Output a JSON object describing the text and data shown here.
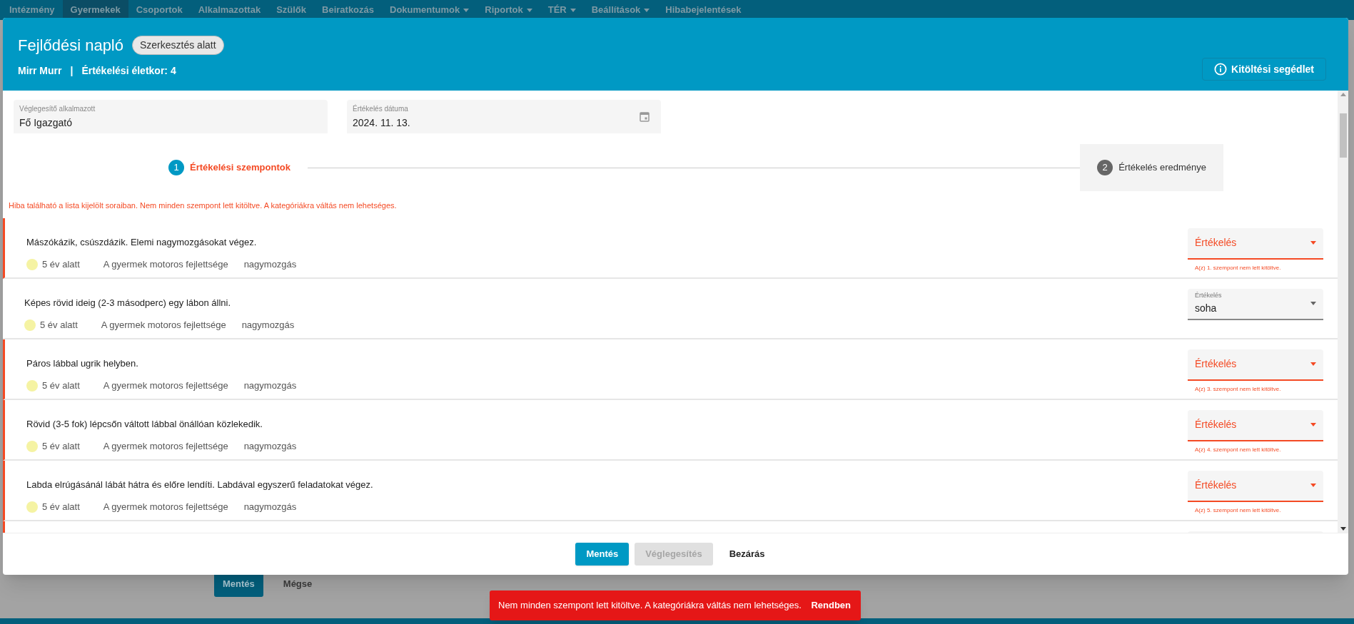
{
  "nav": [
    {
      "label": "Intézmény",
      "selected": false,
      "caret": false
    },
    {
      "label": "Gyermekek",
      "selected": true,
      "caret": false
    },
    {
      "label": "Csoportok",
      "selected": false,
      "caret": false
    },
    {
      "label": "Alkalmazottak",
      "selected": false,
      "caret": false
    },
    {
      "label": "Szülők",
      "selected": false,
      "caret": false
    },
    {
      "label": "Beiratkozás",
      "selected": false,
      "caret": false
    },
    {
      "label": "Dokumentumok",
      "selected": false,
      "caret": true
    },
    {
      "label": "Riportok",
      "selected": false,
      "caret": true
    },
    {
      "label": "TÉR",
      "selected": false,
      "caret": true
    },
    {
      "label": "Beállítások",
      "selected": false,
      "caret": true
    },
    {
      "label": "Hibabejelentések",
      "selected": false,
      "caret": false
    }
  ],
  "background_buttons": [
    {
      "label": "Mentés",
      "kind": "primary"
    },
    {
      "label": "Mégse",
      "kind": "text"
    }
  ],
  "dialog": {
    "title": "Fejlődési napló",
    "badge": "Szerkesztés alatt",
    "child": "Mirr Murr",
    "separator": "|",
    "age": "Értékelési életkor: 4",
    "help_button": "Kitöltési segédlet",
    "fields": [
      {
        "label": "Véglegesítő alkalmazott",
        "value": "Fő Igazgató",
        "kind": "text"
      },
      {
        "label": "Értékelés dátuma",
        "value": "2024. 11. 13.",
        "kind": "date"
      }
    ],
    "steps": [
      {
        "number": "1",
        "label": "Értékelési szempontok",
        "selected": true,
        "error": true
      },
      {
        "number": "2",
        "label": "Értékelés eredménye",
        "selected": false,
        "error": false
      }
    ],
    "error_message": "Hiba található a lista kijelölt soraiban. Nem minden szempont lett kitöltve. A kategóriákra váltás nem lehetséges.",
    "rows": [
      {
        "text": "Mászókázik, csúszdázik. Elemi nagymozgásokat végez.",
        "age": "5 év alatt",
        "color": "#f5f3a3",
        "area": "A gyermek motoros fejlettsége",
        "category": "nagymozgás",
        "error": true,
        "rating_label": "Értékelés",
        "helper": "A(z) 1. szempont nem lett kitöltve."
      },
      {
        "text": "Képes rövid ideig (2-3 másodperc) egy lábon állni.",
        "age": "5 év alatt",
        "color": "#f5f3a3",
        "area": "A gyermek motoros fejlettsége",
        "category": "nagymozgás",
        "error": false,
        "rating_label": "Értékelés",
        "rating_value": "soha"
      },
      {
        "text": "Páros lábbal ugrik helyben.",
        "age": "5 év alatt",
        "color": "#f5f3a3",
        "area": "A gyermek motoros fejlettsége",
        "category": "nagymozgás",
        "error": true,
        "rating_label": "Értékelés",
        "helper": "A(z) 3. szempont nem lett kitöltve."
      },
      {
        "text": "Rövid (3-5 fok) lépcsőn váltott lábbal önállóan közlekedik.",
        "age": "5 év alatt",
        "color": "#f5f3a3",
        "area": "A gyermek motoros fejlettsége",
        "category": "nagymozgás",
        "error": true,
        "rating_label": "Értékelés",
        "helper": "A(z) 4. szempont nem lett kitöltve."
      },
      {
        "text": "Labda elrúgásánál lábát hátra és előre lendíti. Labdával egyszerű feladatokat végez.",
        "age": "5 év alatt",
        "color": "#f5f3a3",
        "area": "A gyermek motoros fejlettsége",
        "category": "nagymozgás",
        "error": true,
        "rating_label": "Értékelés",
        "helper": "A(z) 5. szempont nem lett kitöltve."
      }
    ],
    "buttons": [
      {
        "label": "Mentés",
        "kind": "primary",
        "disabled": false
      },
      {
        "label": "Véglegesítés",
        "kind": "primary",
        "disabled": true
      },
      {
        "label": "Bezárás",
        "kind": "text",
        "disabled": false
      }
    ]
  },
  "snackbar": {
    "message": "Nem minden szempont lett kitöltve. A kategóriákra váltás nem lehetséges.",
    "action": "Rendben"
  }
}
